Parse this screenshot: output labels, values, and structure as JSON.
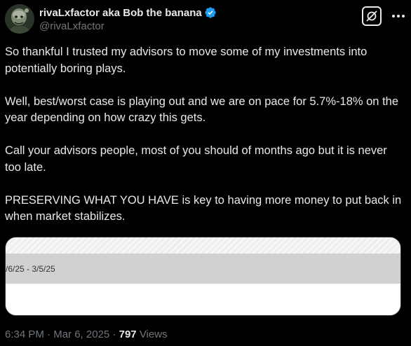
{
  "author": {
    "display_name": "rivaLxfactor aka Bob the banana",
    "handle": "@rivaLxfactor",
    "verified": true,
    "verified_color": "#1d9bf0"
  },
  "tweet": {
    "paragraphs": [
      "So thankful I trusted my advisors to move some of my investments into potentially boring plays.",
      "Well, best/worst case is playing out and we are on pace for 5.7%-18% on the year depending on how crazy this gets.",
      "Call your advisors people, most of you should of months ago but it is never too late.",
      "PRESERVING WHAT YOU HAVE is key to having more money to put back in when market stabilizes."
    ]
  },
  "media": {
    "date_range": "/6/25 - 3/5/25"
  },
  "meta": {
    "time": "6:34 PM",
    "separator": "·",
    "date": "Mar 6, 2025",
    "views_count": "797",
    "views_label": "Views"
  },
  "icons": {
    "avatar": "avatar-image",
    "verified": "verified-badge-icon",
    "grok": "grok-icon",
    "more": "more-options-icon"
  },
  "colors": {
    "background": "#000000",
    "text_primary": "#e7e9ea",
    "text_secondary": "#71767b",
    "accent": "#1d9bf0"
  }
}
